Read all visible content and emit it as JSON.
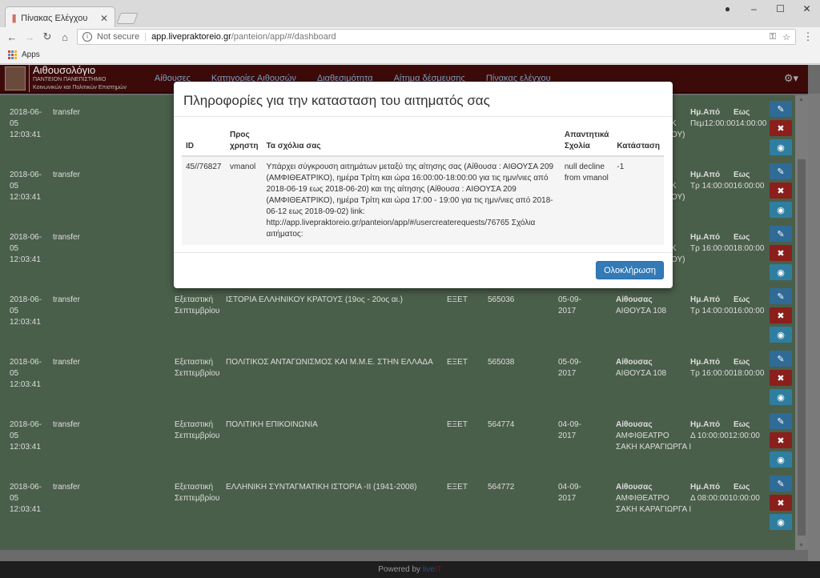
{
  "browser": {
    "tab_title": "Πίνακας Ελέγχου",
    "address_security": "Not secure",
    "address_host": "app.livepraktoreio.gr",
    "address_path": "/panteion/app/#/dashboard",
    "bookmarks_apps": "Apps"
  },
  "app": {
    "brand_title": "Αιθουσολόγιο",
    "brand_line1": "ΠΑΝΤΕΙΟΝ ΠΑΝΕΠΙΣΤΗΜΙΟ",
    "brand_line2": "Κοινωνικών και Πολιτικών Επιστημών",
    "nav": [
      "Αίθουσες",
      "Κατηγορίες Αιθουσών",
      "Διαθεσιμότητα",
      "Αίτημα δέσμευσης",
      "Πίνακας ελέγχου"
    ],
    "footer_prefix": "Powered by",
    "footer_brand_1": "live",
    "footer_brand_2": "IT"
  },
  "labels": {
    "room": "Αίθουσας",
    "from": "Ημ.Από",
    "to": "Εως"
  },
  "rows": [
    {
      "date": "2018-06-",
      "date2": "05",
      "time": "12:03:41",
      "type": "transfer",
      "period": "",
      "period2": "",
      "course": "",
      "dept": "",
      "code": "",
      "sdate": "",
      "sdate2": "",
      "room": "",
      "room2": "",
      "day": "Κ",
      "day2": "ΟΥ)",
      "slot": "Πεμ12:00:0014:00:00"
    },
    {
      "date": "2018-06-",
      "date2": "05",
      "time": "12:03:41",
      "type": "transfer",
      "period": "",
      "period2": "",
      "course": "",
      "dept": "",
      "code": "",
      "sdate": "",
      "sdate2": "",
      "room": "",
      "room2": "",
      "day": "Κ",
      "day2": "ΟΥ)",
      "slot": "Τρ  14:00:0016:00:00"
    },
    {
      "date": "2018-06-",
      "date2": "05",
      "time": "12:03:41",
      "type": "transfer",
      "period": "",
      "period2": "",
      "course": "",
      "dept": "",
      "code": "",
      "sdate": "",
      "sdate2": "",
      "room": "",
      "room2": "",
      "day": "Κ",
      "day2": "ΟΥ)",
      "slot": "Τρ  16:00:0018:00:00"
    },
    {
      "date": "2018-06-",
      "date2": "05",
      "time": "12:03:41",
      "type": "transfer",
      "period": "Εξεταστική",
      "period2": "Σεπτεμβρίου",
      "course": "ΙΣΤΟΡΙΑ ΕΛΛΗΝΙΚΟΥ ΚΡΑΤΟΥΣ (19ος - 20ος αι.)",
      "dept": "ΕΞΕΤ",
      "code": "565036",
      "sdate": "05-09-",
      "sdate2": "2017",
      "room": "ΑΙΘΟΥΣΑ 108",
      "room2": "",
      "day": "",
      "day2": "",
      "slot": "Τρ  14:00:0016:00:00"
    },
    {
      "date": "2018-06-",
      "date2": "05",
      "time": "12:03:41",
      "type": "transfer",
      "period": "Εξεταστική",
      "period2": "Σεπτεμβρίου",
      "course": "ΠΟΛΙΤΙΚΟΣ ΑΝΤΑΓΩΝΙΣΜΟΣ ΚΑΙ Μ.Μ.Ε. ΣΤΗΝ ΕΛΛΑΔΑ",
      "dept": "ΕΞΕΤ",
      "code": "565038",
      "sdate": "05-09-",
      "sdate2": "2017",
      "room": "ΑΙΘΟΥΣΑ 108",
      "room2": "",
      "day": "",
      "day2": "",
      "slot": "Τρ  16:00:0018:00:00"
    },
    {
      "date": "2018-06-",
      "date2": "05",
      "time": "12:03:41",
      "type": "transfer",
      "period": "Εξεταστική",
      "period2": "Σεπτεμβρίου",
      "course": "ΠΟΛΙΤΙΚΗ ΕΠΙΚΟΙΝΩΝΙΑ",
      "dept": "ΕΞΕΤ",
      "code": "564774",
      "sdate": "04-09-",
      "sdate2": "2017",
      "room": "ΑΜΦΙΘΕΑΤΡΟ",
      "room2": "ΣΑΚΗ ΚΑΡΑΓΙΩΡΓΑ Ι",
      "day": "",
      "day2": "",
      "slot": "Δ    10:00:0012:00:00"
    },
    {
      "date": "2018-06-",
      "date2": "05",
      "time": "12:03:41",
      "type": "transfer",
      "period": "Εξεταστική",
      "period2": "Σεπτεμβρίου",
      "course": "ΕΛΛΗΝΙΚΗ ΣΥΝΤΑΓΜΑΤΙΚΗ ΙΣΤΟΡΙΑ -ΙΙ (1941-2008)",
      "dept": "ΕΞΕΤ",
      "code": "564772",
      "sdate": "04-09-",
      "sdate2": "2017",
      "room": "ΑΜΦΙΘΕΑΤΡΟ",
      "room2": "ΣΑΚΗ ΚΑΡΑΓΙΩΡΓΑ Ι",
      "day": "",
      "day2": "",
      "slot": "Δ    08:00:0010:00:00"
    }
  ],
  "modal": {
    "title": "Πληροφορίες για την κατασταση του αιτηματός σας",
    "headers": {
      "id": "ID",
      "user": "Προς χρηστη",
      "comments": "Τα σχόλια σας",
      "reply": "Απαντητικά Σχολία",
      "status": "Κατάσταση"
    },
    "row": {
      "id": "45//76827",
      "user": "vmanol",
      "comments": "Υπάρχει σύγκρουση αιτημάτων μεταξύ της αίτησης σας (Αίθουσα : ΑΙΘΟΥΣΑ 209 (ΑΜΦΙΘΕΑΤΡΙΚΟ), ημέρα Τρίτη και ώρα 16:00:00-18:00:00 για τις ημν/νιες από 2018-06-19 εως 2018-06-20) και της αίτησης (Αίθουσα : ΑΙΘΟΥΣΑ 209 (ΑΜΦΙΘΕΑΤΡΙΚΟ), ημέρα Τρίτη και ώρα 17:00 - 19:00 για τις ημν/νιες από 2018-06-12 εως 2018-09-02) link: http://app.livepraktoreio.gr/panteion/app/#/usercreaterequests/76765 Σχόλια αιτήματος:",
      "reply": "null decline from vmanol",
      "status": "-1"
    },
    "close_label": "Ολοκλήρωση"
  },
  "colors": {
    "navbar": "#3d0a0a",
    "primary_button": "#337ab7",
    "edit_button": "#2f6b96",
    "delete_button": "#8a1f1c",
    "view_button": "#2f7ea0"
  }
}
